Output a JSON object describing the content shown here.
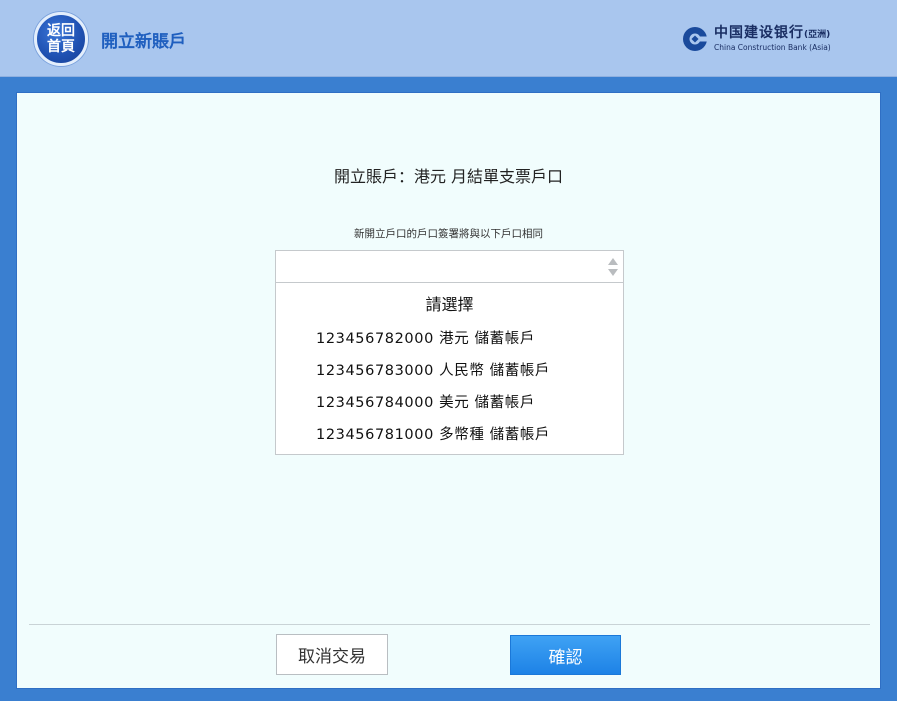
{
  "header": {
    "home_button": [
      "返回",
      "首頁"
    ],
    "title": "開立新賬戶",
    "logo": {
      "cn": "中国建设银行",
      "cn_suffix": "(亞洲)",
      "en": "China Construction Bank (Asia)"
    }
  },
  "main": {
    "title": "開立賬戶：港元 月結單支票戶口",
    "subtitle": "新開立戶口的戶口簽署將與以下戶口相同",
    "select": {
      "value": "",
      "placeholder": "請選擇",
      "options": [
        "123456782000 港元 儲蓄帳戶",
        "123456783000 人民幣 儲蓄帳戶",
        "123456784000 美元 儲蓄帳戶",
        "123456781000 多幣種 儲蓄帳戶"
      ]
    }
  },
  "footer": {
    "cancel_label": "取消交易",
    "confirm_label": "確認"
  },
  "colors": {
    "frame_blue": "#3a7fd0",
    "header_bg": "#a9c6ee",
    "panel_bg": "#f1fdfd",
    "confirm_blue": "#2a8ff0",
    "title_blue": "#1f5fbf"
  },
  "icons": {
    "home": "home-badge-icon",
    "logo": "ccb-logo-icon",
    "select_arrows": "up-down-arrows-icon"
  }
}
